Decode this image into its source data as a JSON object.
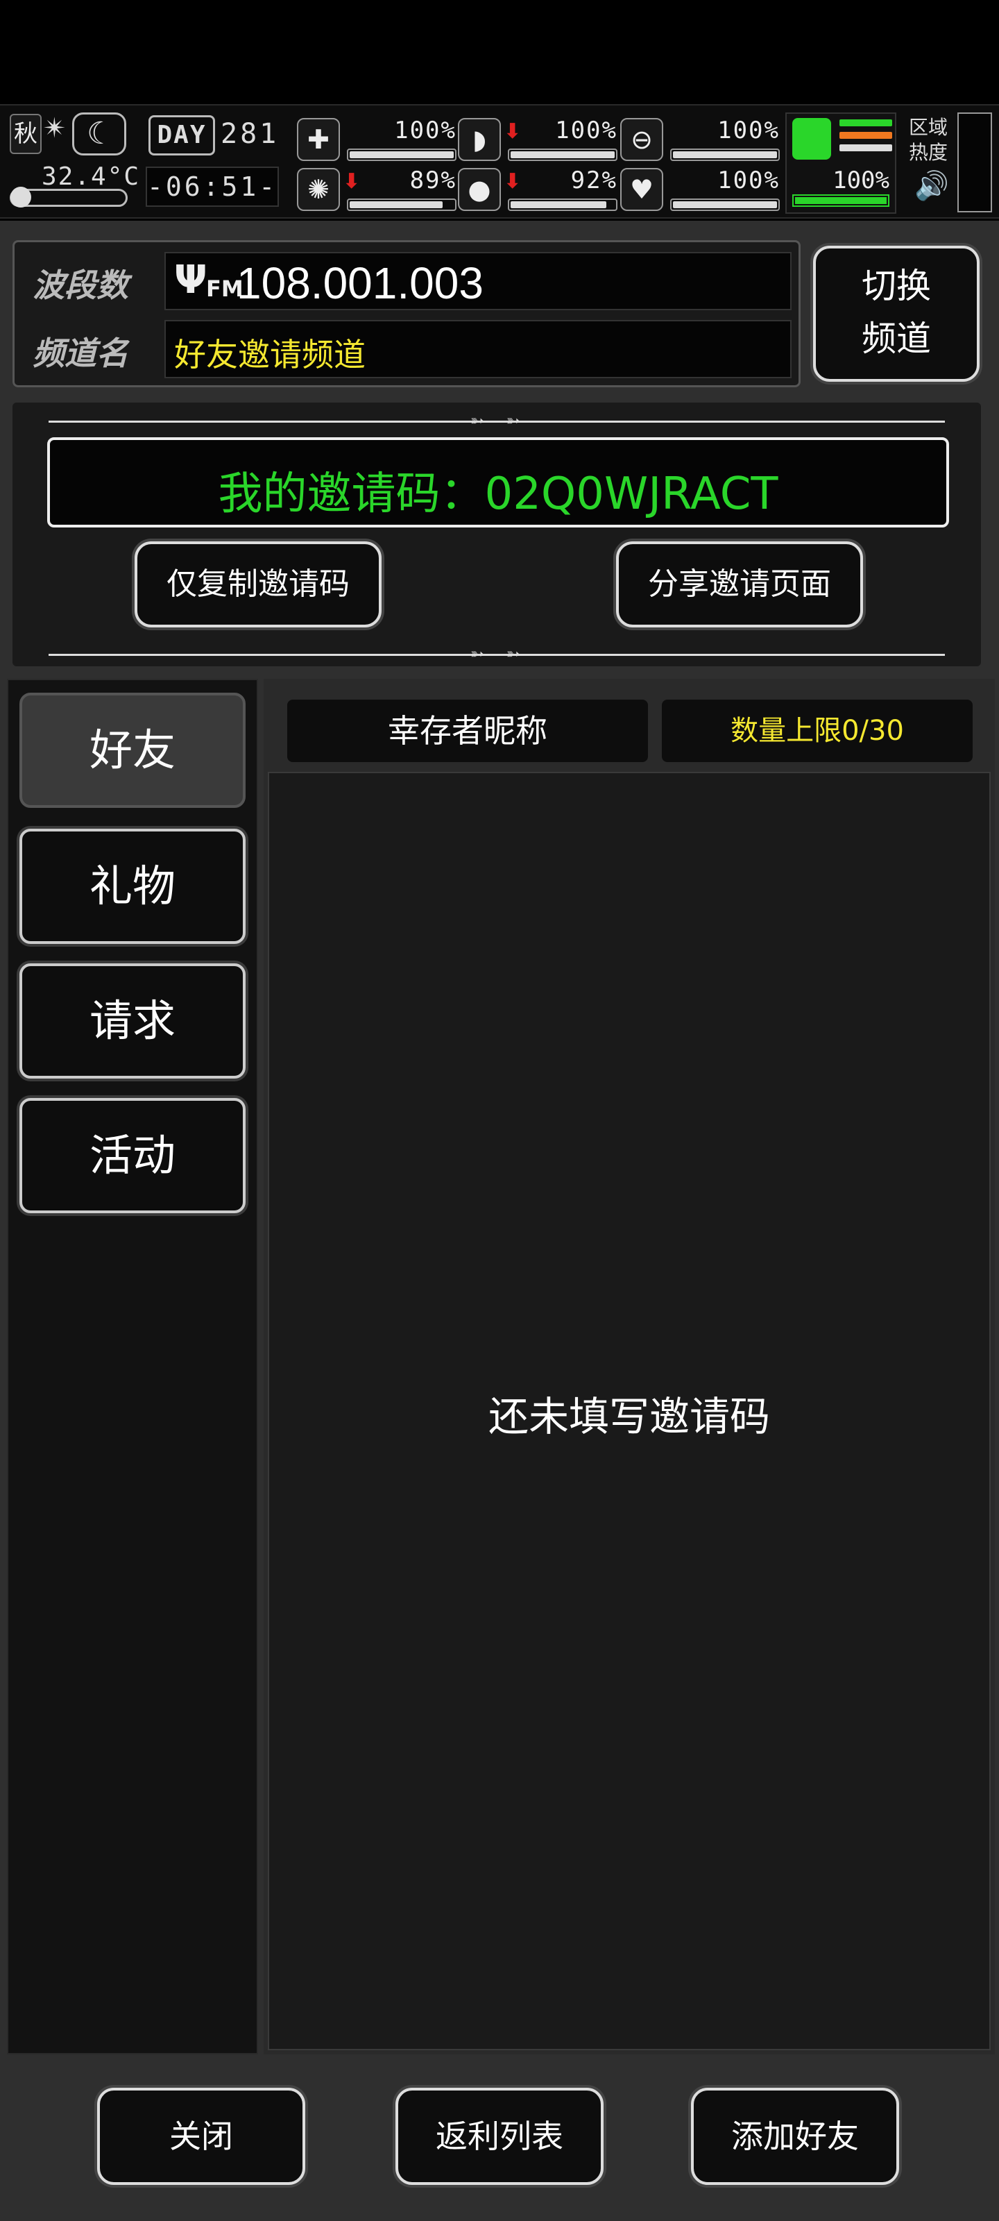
{
  "status": {
    "season": "秋",
    "temperature": "32.4°C",
    "day_badge": "DAY",
    "day_number": "281",
    "clock": "-06:51-",
    "stats": [
      {
        "icon": "medkit-icon",
        "glyph": "✚",
        "value": "100%",
        "level": 1.0,
        "arrow": false
      },
      {
        "icon": "stomach-icon",
        "glyph": "◗",
        "value": "100%",
        "level": 1.0,
        "arrow": true
      },
      {
        "icon": "bladder-icon",
        "glyph": "⊖",
        "value": "100%",
        "level": 1.0,
        "arrow": false
      },
      {
        "icon": "brain-icon",
        "glyph": "✺",
        "value": "89%",
        "level": 0.89,
        "arrow": true
      },
      {
        "icon": "water-drop-icon",
        "glyph": "●",
        "value": "92%",
        "level": 0.92,
        "arrow": true
      },
      {
        "icon": "heart-icon",
        "glyph": "♥",
        "value": "100%",
        "level": 1.0,
        "arrow": false
      }
    ],
    "energy_value": "100%",
    "energy_level": 1.0,
    "region_label_1": "区域",
    "region_label_2": "热度",
    "arrow_glyph": "⬇",
    "speaker_glyph": "🔊"
  },
  "radio": {
    "band_label": "波段数",
    "band_value": "108.001.003",
    "fm_glyph": "Ψ",
    "fm_label": "FM",
    "channel_label": "频道名",
    "channel_value": "好友邀请频道",
    "switch_line1": "切换",
    "switch_line2": "频道"
  },
  "invite": {
    "code_text": "我的邀请码：02Q0WJRACT",
    "copy_button": "仅复制邀请码",
    "share_button": "分享邀请页面",
    "divider_glyph": "➳ ➳"
  },
  "tabs": [
    "好友",
    "礼物",
    "请求",
    "活动"
  ],
  "list": {
    "header_name": "幸存者昵称",
    "header_limit": "数量上限0/30",
    "empty_message": "还未填写邀请码"
  },
  "footer": {
    "close": "关闭",
    "rebate": "返利列表",
    "add_friend": "添加好友"
  },
  "colors": {
    "accent_green": "#2ad62a",
    "accent_yellow": "#f5e830",
    "danger_red": "#e02020",
    "orange": "#f07820"
  }
}
